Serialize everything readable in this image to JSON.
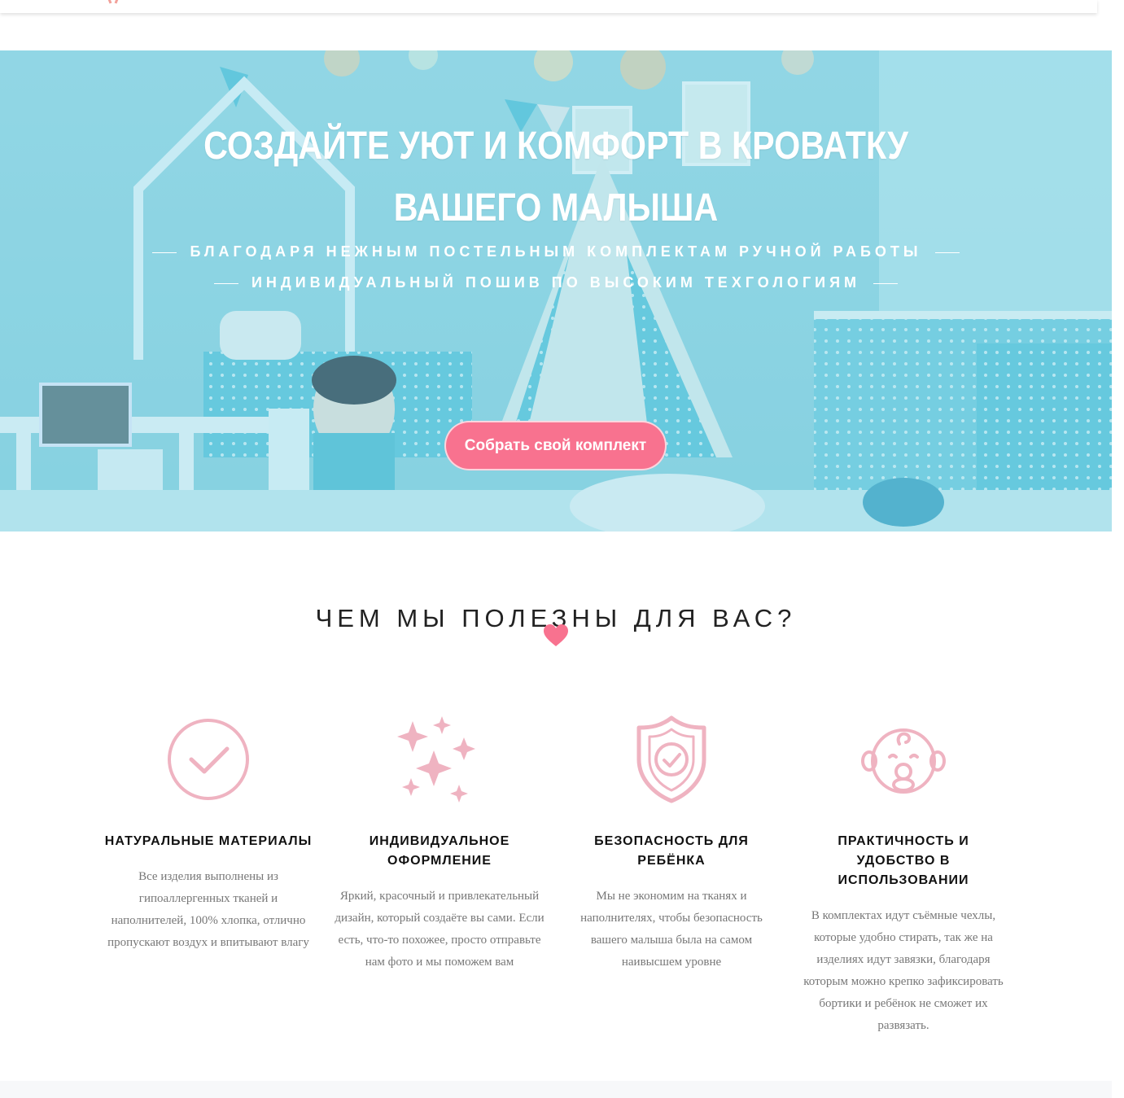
{
  "hero": {
    "title_line1": "СОЗДАЙТЕ УЮТ И КОМФОРТ В КРОВАТКУ",
    "title_line2": "ВАШЕГО МАЛЫША",
    "subtitle_line1": "БЛАГОДАРЯ НЕЖНЫМ ПОСТЕЛЬНЫМ КОМПЛЕКТАМ РУЧНОЙ РАБОТЫ",
    "subtitle_line2": "ИНДИВИДУАЛЬНЫЙ ПОШИВ ПО ВЫСОКИМ ТЕХГОЛОГИЯМ",
    "cta_label": "Собрать свой комплект"
  },
  "benefits": {
    "title": "ЧЕМ МЫ ПОЛЕЗНЫ ДЛЯ ВАС?",
    "items": [
      {
        "icon": "check-circle-icon",
        "title": "НАТУРАЛЬНЫЕ МАТЕРИАЛЫ",
        "desc": "Все изделия выполнены из гипоаллергенных тканей и наполнителей, 100% хлопка, отлично пропускают воздух и впитывают влагу"
      },
      {
        "icon": "sparkles-icon",
        "title": "ИНДИВИДУАЛЬНОЕ ОФОРМЛЕНИЕ",
        "desc": "Яркий, красочный и привлекательный дизайн, который создаёте вы сами. Если есть, что-то похожее, просто отправьте нам фото и мы поможем вам"
      },
      {
        "icon": "shield-check-icon",
        "title": "БЕЗОПАСНОСТЬ ДЛЯ РЕБЁНКА",
        "desc": "Мы не экономим на тканях и наполнителях, чтобы безопасность вашего малыша была на самом наивысшем уровне"
      },
      {
        "icon": "baby-face-icon",
        "title": "ПРАКТИЧНОСТЬ И УДОБСТВО В ИСПОЛЬЗОВАНИИ",
        "desc": "В комплектах идут съёмные чехлы, которые удобно стирать, так же на изделиях идут завязки, благодаря которым можно крепко зафиксировать бортики и ребёнок не сможет их развязать."
      }
    ]
  },
  "colors": {
    "accent_pink": "#f8728f",
    "icon_pink": "#efb3c1",
    "hero_blue": "#7fd0df"
  }
}
